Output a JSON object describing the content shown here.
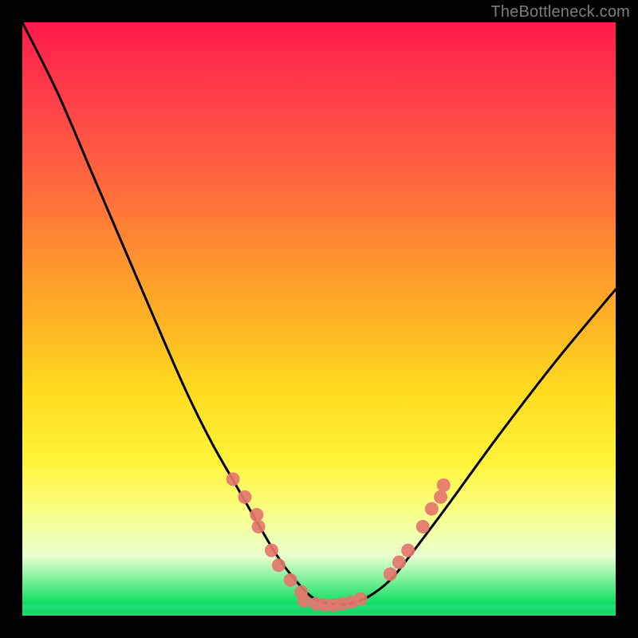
{
  "watermark": "TheBottleneck.com",
  "chart_data": {
    "type": "line",
    "title": "",
    "xlabel": "",
    "ylabel": "",
    "xlim": [
      0,
      100
    ],
    "ylim": [
      0,
      100
    ],
    "series": [
      {
        "name": "bottleneck-curve",
        "x": [
          0,
          6,
          12,
          18,
          24,
          28,
          32,
          36,
          40,
          43,
          46,
          49,
          52,
          55,
          58,
          62,
          66,
          72,
          80,
          90,
          100
        ],
        "y": [
          100,
          88,
          74,
          60,
          46,
          37,
          29,
          22,
          15,
          10,
          6,
          3,
          2,
          2,
          3,
          6,
          11,
          19,
          30,
          43,
          55
        ]
      }
    ],
    "markers": {
      "name": "sample-points",
      "color": "#e4766e",
      "points": [
        {
          "x": 35.5,
          "y": 23
        },
        {
          "x": 37.5,
          "y": 20
        },
        {
          "x": 39.5,
          "y": 17
        },
        {
          "x": 39.8,
          "y": 15
        },
        {
          "x": 42.0,
          "y": 11
        },
        {
          "x": 43.2,
          "y": 8.5
        },
        {
          "x": 45.2,
          "y": 6
        },
        {
          "x": 47.0,
          "y": 4
        },
        {
          "x": 47.5,
          "y": 2.5
        },
        {
          "x": 49.5,
          "y": 2
        },
        {
          "x": 51.0,
          "y": 1.8
        },
        {
          "x": 52.5,
          "y": 1.8
        },
        {
          "x": 54.0,
          "y": 2
        },
        {
          "x": 55.5,
          "y": 2.3
        },
        {
          "x": 57.0,
          "y": 2.8
        },
        {
          "x": 62.0,
          "y": 7
        },
        {
          "x": 63.5,
          "y": 9
        },
        {
          "x": 65.0,
          "y": 11
        },
        {
          "x": 67.5,
          "y": 15
        },
        {
          "x": 69.0,
          "y": 18
        },
        {
          "x": 70.5,
          "y": 20
        },
        {
          "x": 71.0,
          "y": 22
        }
      ]
    },
    "background_gradient": {
      "top": "#ff1a4a",
      "bottom": "#18e07a"
    }
  }
}
